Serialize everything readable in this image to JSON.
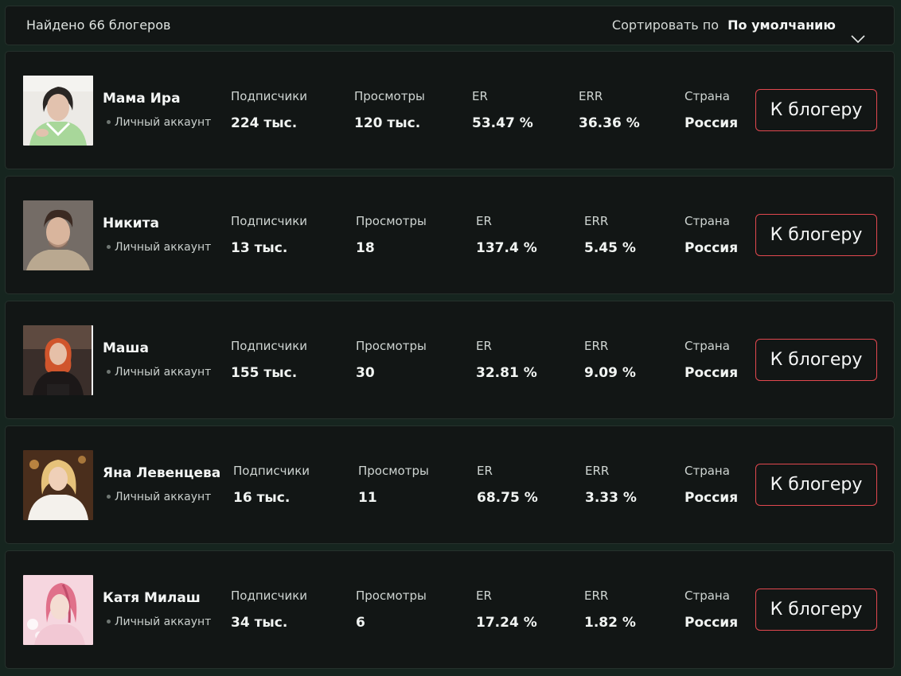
{
  "header": {
    "found_text": "Найдено 66 блогеров",
    "sort_label": "Сортировать по",
    "sort_value": "По умолчанию",
    "sort_icon": "chevron-down-icon"
  },
  "labels": {
    "subscribers": "Подписчики",
    "views": "Просмотры",
    "er": "ER",
    "err": "ERR",
    "country": "Страна",
    "button": "К блогеру"
  },
  "colors": {
    "page_background": "#16251f",
    "card_background": "#121615",
    "button_border": "#e2484f"
  },
  "bloggers": [
    {
      "name": "Мама Ира",
      "account_type": "Личный аккаунт",
      "subscribers": "224 тыс.",
      "views": "120 тыс.",
      "er": "53.47 %",
      "err": "36.36 %",
      "country": "Россия"
    },
    {
      "name": "Никита",
      "account_type": "Личный аккаунт",
      "subscribers": "13 тыс.",
      "views": "18",
      "er": "137.4 %",
      "err": "5.45 %",
      "country": "Россия"
    },
    {
      "name": "Маша",
      "account_type": "Личный аккаунт",
      "subscribers": "155 тыс.",
      "views": "30",
      "er": "32.81 %",
      "err": "9.09 %",
      "country": "Россия"
    },
    {
      "name": "Яна Левенцева",
      "account_type": "Личный аккаунт",
      "subscribers": "16 тыс.",
      "views": "11",
      "er": "68.75 %",
      "err": "3.33 %",
      "country": "Россия"
    },
    {
      "name": "Катя Милаш",
      "account_type": "Личный аккаунт",
      "subscribers": "34 тыс.",
      "views": "6",
      "er": "17.24 %",
      "err": "1.82 %",
      "country": "Россия"
    }
  ]
}
